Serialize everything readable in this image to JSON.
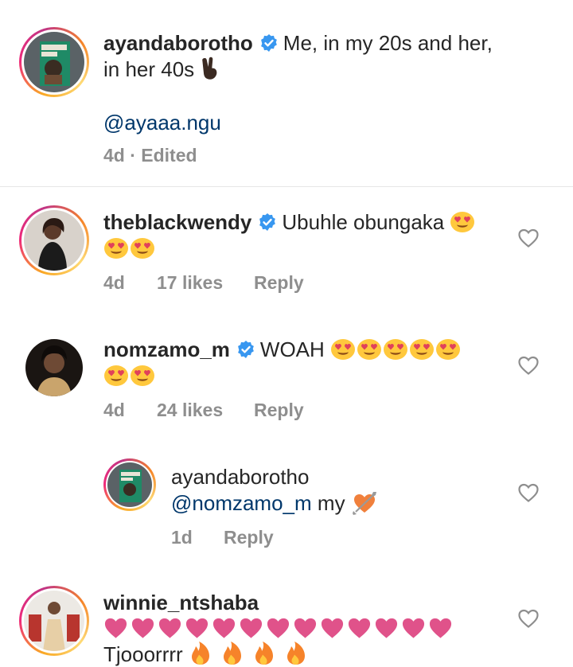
{
  "caption": {
    "username": "ayandaborotho",
    "text_line1": "Me, in my 20s and her,",
    "text_line2": "in her 40s",
    "mention": "@ayaaa.ngu",
    "meta": "4d · Edited"
  },
  "comments": [
    {
      "username": "theblackwendy",
      "text": "Ubuhle obungaka",
      "time": "4d",
      "likes": "17 likes",
      "reply_label": "Reply"
    },
    {
      "username": "nomzamo_m",
      "text": "WOAH",
      "time": "4d",
      "likes": "24 likes",
      "reply_label": "Reply"
    },
    {
      "username": "ayandaborotho",
      "mention": "@nomzamo_m",
      "text": "my",
      "time": "1d",
      "reply_label": "Reply"
    },
    {
      "username": "winnie_ntshaba",
      "text": "Tjooorrrr"
    }
  ],
  "icons": [
    "verified-badge-icon",
    "heart-eyes-emoji",
    "pink-heart-emoji",
    "fire-emoji",
    "victory-hand-emoji",
    "heart-arrow-emoji",
    "like-heart-icon"
  ],
  "colors": {
    "verified": "#3897f0",
    "mention": "#00376b",
    "meta": "#8e8e8e",
    "text": "#262626",
    "heart_emoji": "#e0528a"
  }
}
